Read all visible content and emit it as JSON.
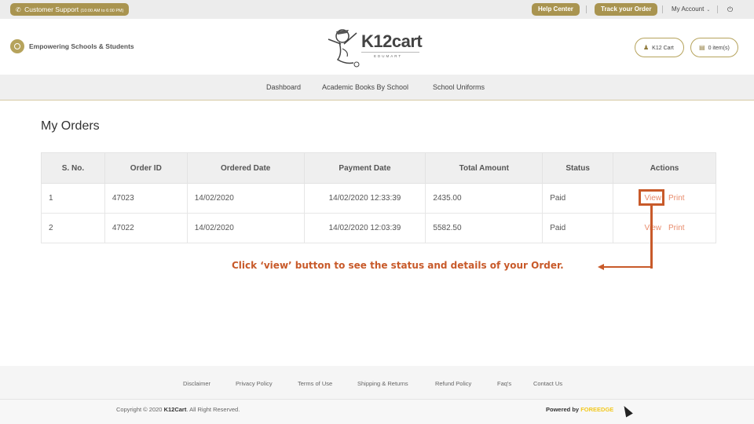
{
  "topbar": {
    "support_label": "Customer Support",
    "support_hours": "(10:00 AM to 6:00 PM)",
    "help_center": "Help Center",
    "track_order": "Track your Order",
    "my_account": "My Account",
    "power_icon": "⏻"
  },
  "header": {
    "tagline": "Empowering Schools & Students",
    "logo_text": "K12cart",
    "logo_sub": "EDUMART",
    "cart_button": "K12 Cart",
    "items_button": "0 item(s)"
  },
  "nav": {
    "items": [
      {
        "label": "Dashboard"
      },
      {
        "label": "Academic Books By School"
      },
      {
        "label": "School Uniforms"
      }
    ]
  },
  "main": {
    "title": "My Orders",
    "table": {
      "headers": [
        "S. No.",
        "Order ID",
        "Ordered Date",
        "Payment Date",
        "Total Amount",
        "Status",
        "Actions"
      ],
      "rows": [
        {
          "sno": "1",
          "order_id": "47023",
          "ordered_date": "14/02/2020",
          "payment_date": "14/02/2020 12:33:39",
          "total": "2435.00",
          "status": "Paid",
          "view": "View",
          "print": "Print"
        },
        {
          "sno": "2",
          "order_id": "47022",
          "ordered_date": "14/02/2020",
          "payment_date": "14/02/2020 12:03:39",
          "total": "5582.50",
          "status": "Paid",
          "view": "View",
          "print": "Print"
        }
      ]
    },
    "callout": "Click ‘view’ button to see the status and details of your Order."
  },
  "footer": {
    "links": [
      "Disclaimer",
      "Privacy Policy",
      "Terms of Use",
      "Shipping & Returns",
      "Refund Policy",
      "Faq's",
      "Contact Us"
    ],
    "copyright_prefix": "Copyright © 2020 ",
    "copyright_brand": "K12Cart",
    "copyright_suffix": ". All Right Reserved.",
    "powered_by": "Powered by ",
    "powered_brand": "FOREEDGE"
  },
  "colors": {
    "gold": "#a99450",
    "annotation": "#c85a2a",
    "action_link": "#e88a6a"
  }
}
